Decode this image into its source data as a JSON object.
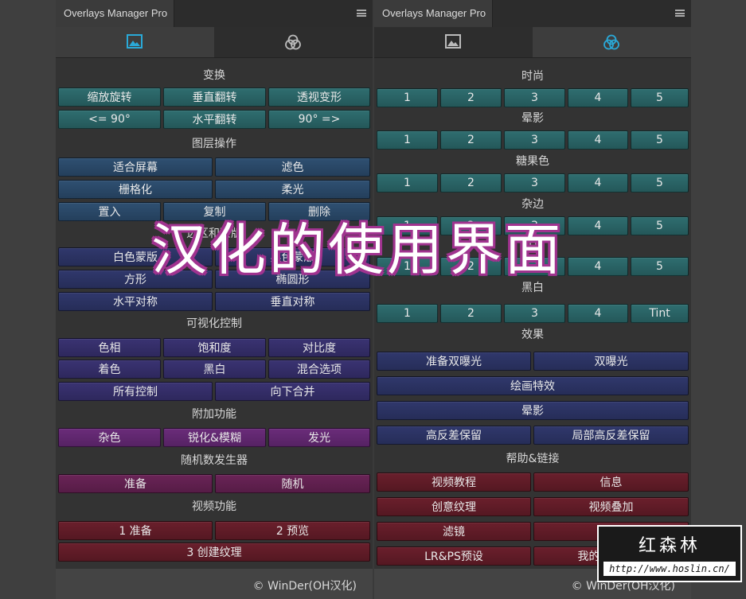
{
  "colors": {
    "teal": "#2f6e70",
    "blue": "#2f5072",
    "navy": "#30386c",
    "indigo": "#3a3372",
    "violet": "#6a2c7a",
    "plum": "#6a2457",
    "red": "#6a1f2c",
    "icon_active": "#2aa9d8",
    "overlay_outline": "#a0338f"
  },
  "left_panel": {
    "title": "Overlays Manager Pro",
    "icon_tabs": [
      "image-icon",
      "color-circles-icon"
    ],
    "sections": {
      "transform": {
        "heading": "变换",
        "row1": [
          "缩放旋转",
          "垂直翻转",
          "透视变形"
        ],
        "row2": [
          "<= 90°",
          "水平翻转",
          "90° =>"
        ]
      },
      "layers": {
        "heading": "图层操作",
        "row1": [
          "适合屏幕",
          "滤色"
        ],
        "row2": [
          "栅格化",
          "柔光"
        ],
        "row3": [
          "置入",
          "复制",
          "删除"
        ]
      },
      "masks": {
        "heading": "选区和蒙版",
        "row1": [
          "白色蒙版",
          "黑色蒙版"
        ],
        "row2": [
          "方形",
          "椭圆形"
        ],
        "row3": [
          "水平对称",
          "垂直对称"
        ]
      },
      "visual": {
        "heading": "可视化控制",
        "row1": [
          "色相",
          "饱和度",
          "对比度"
        ],
        "row2": [
          "着色",
          "黑白",
          "混合选项"
        ],
        "row3": [
          "所有控制",
          "向下合并"
        ]
      },
      "extras": {
        "heading": "附加功能",
        "row1": [
          "杂色",
          "锐化&模糊",
          "发光"
        ]
      },
      "random": {
        "heading": "随机数发生器",
        "row1": [
          "准备",
          "随机"
        ]
      },
      "video": {
        "heading": "视频功能",
        "row1": [
          "1 准备",
          "2 预览"
        ],
        "row2": [
          "3 创建纹理"
        ]
      }
    },
    "footer": "© WinDer(OH汉化)"
  },
  "right_panel": {
    "title": "Overlays Manager Pro",
    "icon_tabs": [
      "image-icon",
      "color-circles-icon"
    ],
    "sections": {
      "fashion": {
        "heading": "时尚",
        "row1": [
          "1",
          "2",
          "3",
          "4",
          "5"
        ]
      },
      "vignette": {
        "heading": "晕影",
        "row1": [
          "1",
          "2",
          "3",
          "4",
          "5"
        ]
      },
      "candy": {
        "heading": "糖果色",
        "row1": [
          "1",
          "2",
          "3",
          "4",
          "5"
        ]
      },
      "border": {
        "heading": "杂边",
        "row1": [
          "1",
          "2",
          "3",
          "4",
          "5"
        ]
      },
      "hdr": {
        "heading": "HDR",
        "row1": [
          "1",
          "2",
          "3",
          "4",
          "5"
        ]
      },
      "bw": {
        "heading": "黑白",
        "row1": [
          "1",
          "2",
          "3",
          "4",
          "Tint"
        ]
      },
      "effects": {
        "heading": "效果",
        "row1": [
          "准备双曝光",
          "双曝光"
        ],
        "row2": [
          "绘画特效"
        ],
        "row3": [
          "晕影"
        ],
        "row4": [
          "高反差保留",
          "局部高反差保留"
        ]
      },
      "help": {
        "heading": "帮助&链接",
        "row1": [
          "视频教程",
          "信息"
        ],
        "row2": [
          "创意纹理",
          "视频叠加"
        ],
        "row3": [
          "滤镜",
          "动作"
        ],
        "row4": [
          "LR&PS预设",
          "我的其他产品"
        ]
      }
    },
    "footer": "© WinDer(OH汉化)"
  },
  "overlay_title": "汉化的使用界面",
  "watermark": {
    "name": "红森林",
    "url": "http://www.hoslin.cn/"
  }
}
